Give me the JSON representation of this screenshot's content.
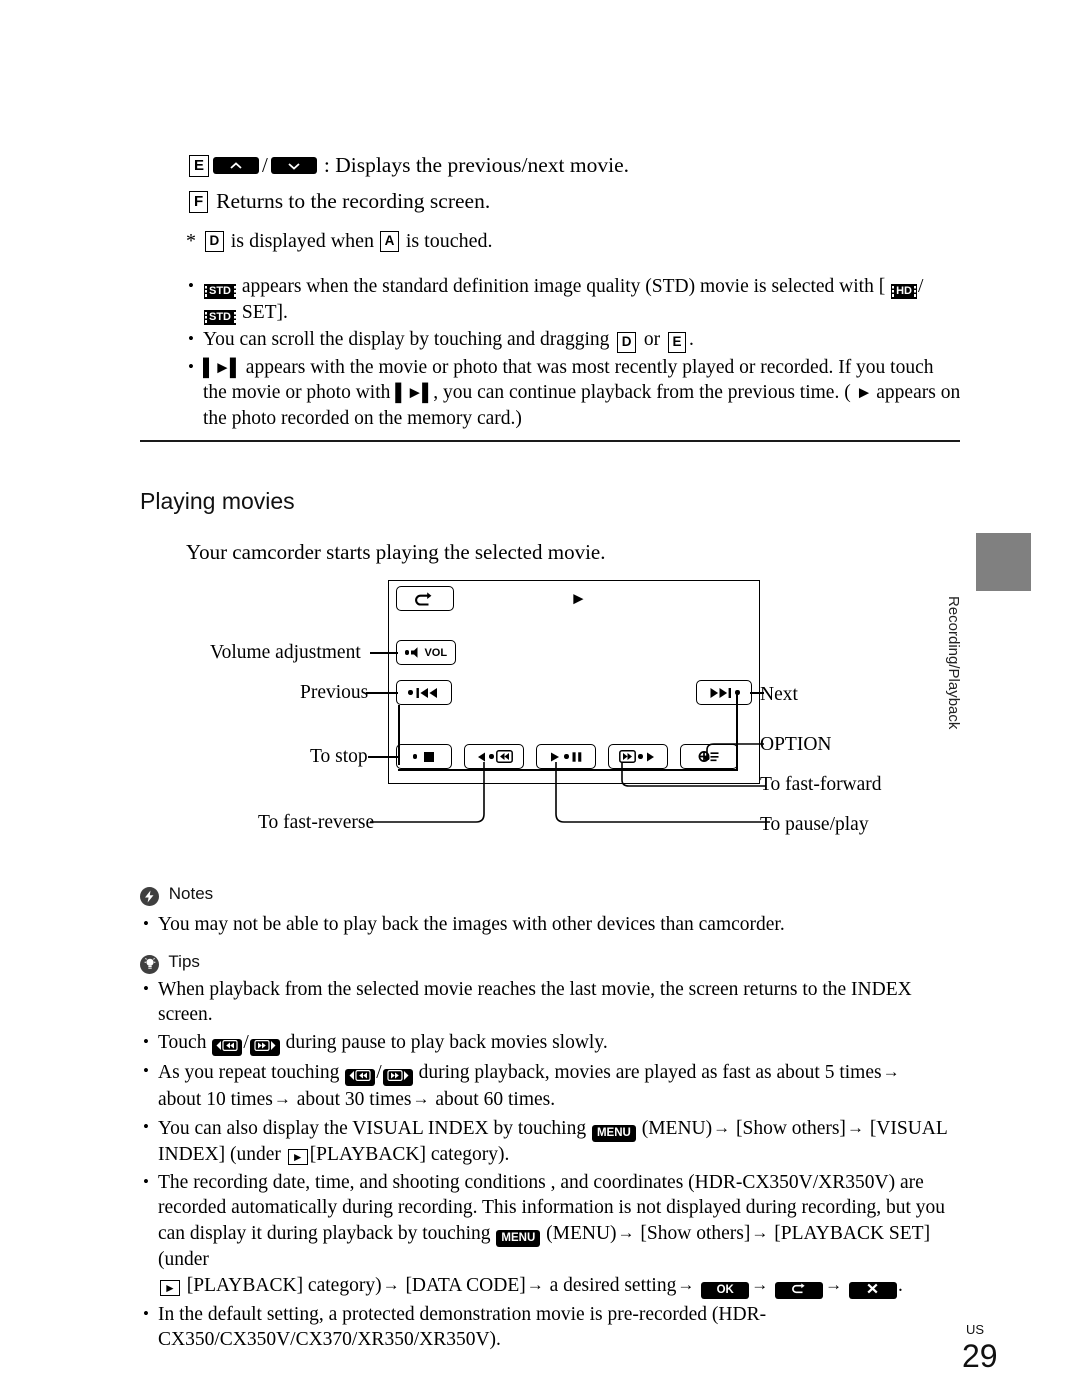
{
  "page": {
    "number": "29",
    "region_label": "US",
    "side_tab": "Recording/Playback"
  },
  "top_items": [
    {
      "letter": "E",
      "text": ": Displays the previous/next movie."
    },
    {
      "letter": "F",
      "text": "Returns to the recording screen."
    }
  ],
  "footnote": {
    "star": "*",
    "part1": "is displayed when",
    "part2": "is touched.",
    "letter1": "D",
    "letter2": "A"
  },
  "bullets": [
    {
      "id": "std-bullet",
      "badge": "STD",
      "text_a": "appears when the standard definition image quality (STD) movie is selected with [",
      "badge2": "HD",
      "text_b": "/",
      "badge3": "STD",
      "text_c": "SET]."
    },
    {
      "id": "scroll-bullet",
      "text_a": "You can scroll the display by touching and dragging",
      "letter1": "D",
      "text_b": "or",
      "letter2": "E",
      "text_c": "."
    },
    {
      "id": "resume-bullet",
      "text_a": "appears with the movie or photo that was most recently played or recorded. If you touch the movie or photo with",
      "text_b": ", you can continue playback from the previous time. (",
      "text_c": "appears on the photo recorded on the memory card.)"
    }
  ],
  "section": {
    "heading": "Playing movies",
    "intro": "Your camcorder starts playing the selected movie."
  },
  "diagram": {
    "labels": {
      "volume": "Volume adjustment",
      "previous": "Previous",
      "to_stop": "To stop",
      "to_fast_reverse": "To fast-reverse",
      "next": "Next",
      "option": "OPTION",
      "to_fast_forward": "To fast-forward",
      "to_pause_play": "To pause/play"
    },
    "buttons": {
      "return": "return-arrow",
      "play_indicator": "play-triangle",
      "volume": "VOL",
      "previous": "prev-track",
      "next": "next-track",
      "stop": "stop-square",
      "fast_reverse": "fast-reverse",
      "pause_play": "play-pause",
      "fast_forward": "fast-forward",
      "option": "option-gear"
    }
  },
  "notes": {
    "heading": "Notes",
    "icon": "lightning-icon",
    "items": [
      "You may not be able to play back the images with other devices than camcorder."
    ]
  },
  "tips": {
    "heading": "Tips",
    "icon": "lightbulb-icon",
    "items": [
      {
        "id": "tip-index",
        "text": "When playback from the selected movie reaches the last movie, the screen returns to the INDEX screen."
      },
      {
        "id": "tip-slow",
        "a": "Touch",
        "b": "/",
        "c": "during pause to play back movies slowly."
      },
      {
        "id": "tip-speed",
        "a": "As you repeat touching",
        "b": "/",
        "c": "during playback, movies are played as fast as about 5 times",
        "d": "about 10 times",
        "e": "about 30 times",
        "f": "about 60 times."
      },
      {
        "id": "tip-visual-index",
        "a": "You can also display the VISUAL INDEX by touching",
        "menu_key": "MENU",
        "b": "(MENU)",
        "c": "[Show others]",
        "d": "[VISUAL INDEX] (under",
        "e": "[PLAYBACK] category)."
      },
      {
        "id": "tip-data-code",
        "a": "The recording date, time, and shooting conditions , and coordinates (HDR-CX350V/XR350V) are recorded automatically during recording. This information is not displayed during recording, but you can display it during playback by touching",
        "menu_key": "MENU",
        "b": "(MENU)",
        "c": "[Show others]",
        "d": "[PLAYBACK SET] (under",
        "e": "[PLAYBACK] category)",
        "f": "[DATA CODE]",
        "g": "a desired setting",
        "ok_key": "OK",
        "back_key": "back-arrow",
        "close_key": "close-x",
        "h": "."
      },
      {
        "id": "tip-demo",
        "text": "In the default setting, a protected demonstration movie is pre-recorded (HDR-CX350/CX350V/CX370/XR350/XR350V)."
      }
    ]
  }
}
